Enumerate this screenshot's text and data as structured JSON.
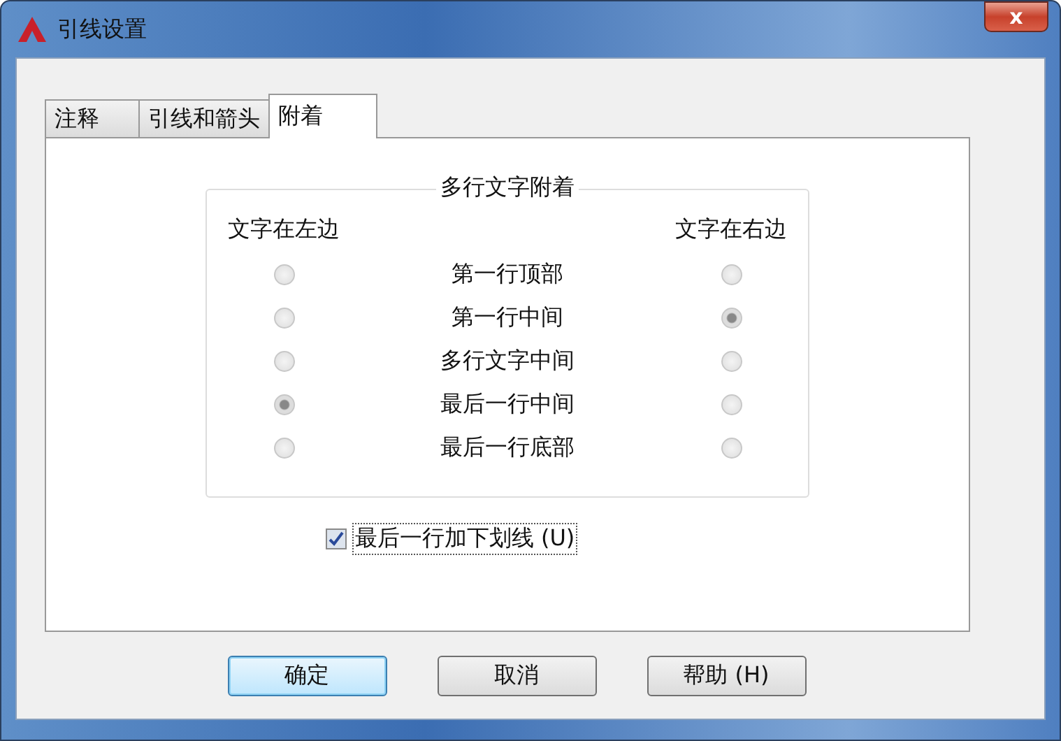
{
  "window": {
    "title": "引线设置",
    "close": "x"
  },
  "tabs": [
    {
      "label": "注释",
      "selected": false
    },
    {
      "label": "引线和箭头",
      "selected": false
    },
    {
      "label": "附着",
      "selected": true
    }
  ],
  "group": {
    "title": "多行文字附着",
    "left_heading": "文字在左边",
    "right_heading": "文字在右边",
    "rows": [
      {
        "label": "第一行顶部",
        "left_selected": false,
        "right_selected": false
      },
      {
        "label": "第一行中间",
        "left_selected": false,
        "right_selected": true
      },
      {
        "label": "多行文字中间",
        "left_selected": false,
        "right_selected": false
      },
      {
        "label": "最后一行中间",
        "left_selected": true,
        "right_selected": false
      },
      {
        "label": "最后一行底部",
        "left_selected": false,
        "right_selected": false
      }
    ]
  },
  "underline": {
    "label": "最后一行加下划线 (U)",
    "checked": true
  },
  "buttons": [
    {
      "label": "确定",
      "default": true
    },
    {
      "label": "取消",
      "default": false
    },
    {
      "label": "帮助 (H)",
      "default": false
    }
  ]
}
